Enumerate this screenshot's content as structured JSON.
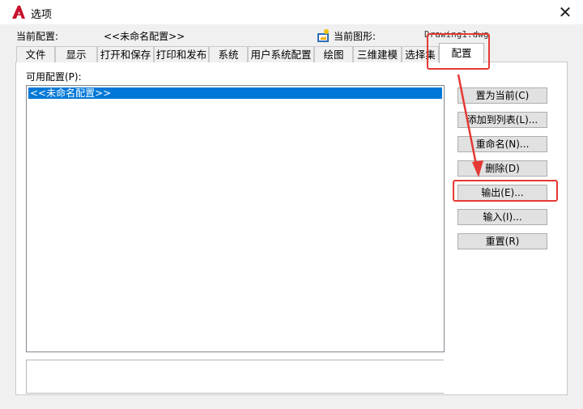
{
  "window": {
    "title": "选项",
    "close_symbol": "✕"
  },
  "info": {
    "profile_label": "当前配置:",
    "profile_value": "<<未命名配置>>",
    "drawing_label": "当前图形:",
    "drawing_value": "Drawing1.dwg"
  },
  "tabs": [
    "文件",
    "显示",
    "打开和保存",
    "打印和发布",
    "系统",
    "用户系统配置",
    "绘图",
    "三维建模",
    "选择集",
    "配置"
  ],
  "active_tab": "配置",
  "profiles": {
    "label": "可用配置(P):",
    "items": [
      "<<未命名配置>>"
    ],
    "selected": "<<未命名配置>>"
  },
  "buttons": {
    "set_current": "置为当前(C)",
    "add_to_list": "添加到列表(L)...",
    "rename": "重命名(N)...",
    "delete": "删除(D)",
    "export": "输出(E)...",
    "import": "输入(I)...",
    "reset": "重置(R)"
  },
  "colors": {
    "selection": "#0078d7",
    "highlight": "#e53935"
  }
}
